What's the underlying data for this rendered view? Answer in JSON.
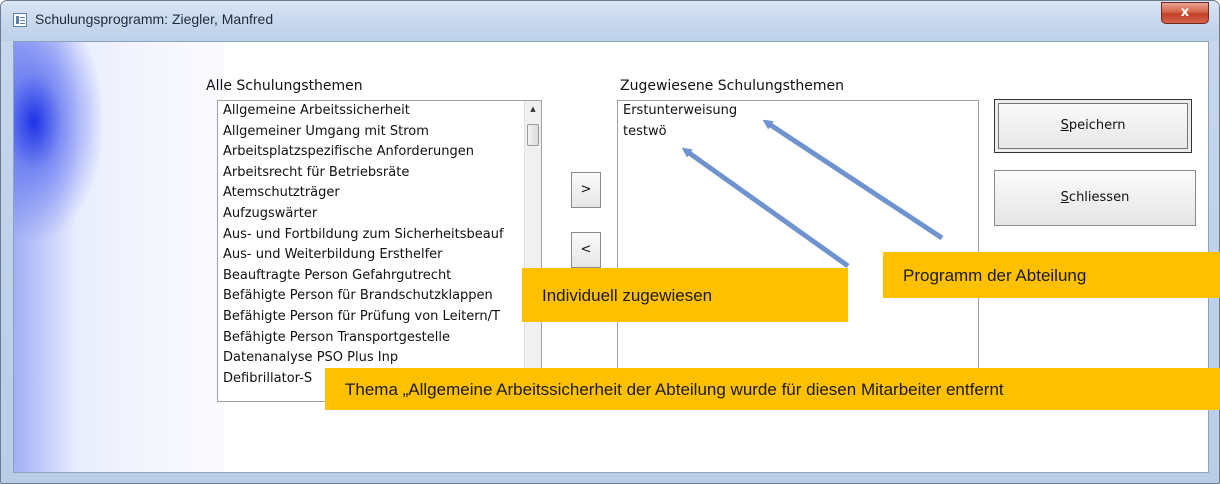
{
  "window": {
    "title": "Schulungsprogramm: Ziegler, Manfred",
    "close_glyph": "x",
    "icon": "form-window-icon"
  },
  "left_panel": {
    "label": "Alle Schulungsthemen",
    "items": [
      "Allgemeine Arbeitssicherheit",
      "Allgemeiner Umgang mit Strom",
      "Arbeitsplatzspezifische Anforderungen",
      "Arbeitsrecht für Betriebsräte",
      "Atemschutzträger",
      "Aufzugswärter",
      "Aus- und Fortbildung zum Sicherheitsbeauf",
      "Aus- und Weiterbildung Ersthelfer",
      "Beauftragte Person Gefahrgutrecht",
      "Befähigte Person für Brandschutzklappen",
      "Befähigte Person für Prüfung von Leitern/T",
      "Befähigte Person Transportgestelle",
      "Datenanalyse PSO Plus Inp",
      "Defibrillator-S"
    ]
  },
  "right_panel": {
    "label": "Zugewiesene Schulungsthemen",
    "items": [
      "Erstunterweisung",
      "testwö"
    ]
  },
  "buttons": {
    "add": ">",
    "remove": "<",
    "save_hotkey": "S",
    "save_rest": "peichern",
    "close_hotkey": "S",
    "close_rest": "chliessen"
  },
  "annotations": {
    "department": "Programm der Abteilung",
    "individual": "Individuell zugewiesen",
    "removed": "Thema „Allgemeine Arbeitssicherheit der Abteilung wurde für diesen Mitarbeiter  entfernt"
  },
  "colors": {
    "callout": "#ffc000",
    "arrow": "#6f93cf",
    "close_button": "#c2402a"
  }
}
